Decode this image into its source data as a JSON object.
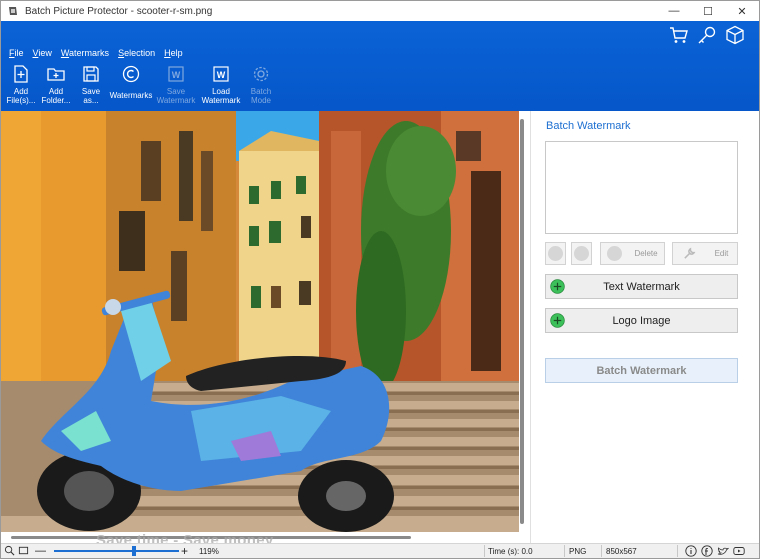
{
  "window": {
    "title": "Batch Picture Protector - scooter-r-sm.png",
    "minimize": "—",
    "maximize": "☐",
    "close": "✕"
  },
  "menu": [
    "File",
    "View",
    "Watermarks",
    "Selection",
    "Help"
  ],
  "toolbar": [
    {
      "label": "Add\nFile(s)...",
      "icon": "add-file-icon",
      "enabled": true
    },
    {
      "label": "Add\nFolder...",
      "icon": "add-folder-icon",
      "enabled": true
    },
    {
      "label": "Save\nas...",
      "icon": "save-icon",
      "enabled": true
    },
    {
      "label": "Watermarks",
      "icon": "copyright-icon",
      "enabled": true
    },
    {
      "label": "Save\nWatermark",
      "icon": "save-watermark-icon",
      "enabled": false
    },
    {
      "label": "Load\nWatermark",
      "icon": "load-watermark-icon",
      "enabled": true
    },
    {
      "label": "Batch\nMode",
      "icon": "gear-icon",
      "enabled": false
    }
  ],
  "top_icons": [
    "cart-icon",
    "key-icon",
    "box-icon"
  ],
  "panel": {
    "title": "Batch Watermark",
    "delete_label": "Delete",
    "edit_label": "Edit",
    "text_watermark_label": "Text Watermark",
    "logo_image_label": "Logo Image",
    "batch_label": "Batch Watermark"
  },
  "status": {
    "zoom": "119%",
    "time": "Time (s): 0.0",
    "format": "PNG",
    "dimensions": "850x567",
    "slogan": "Save time - Save money"
  },
  "colors": {
    "ribbon": "#0a63d6",
    "accent": "#1d6fd1",
    "plus_green": "#3cc15a"
  }
}
